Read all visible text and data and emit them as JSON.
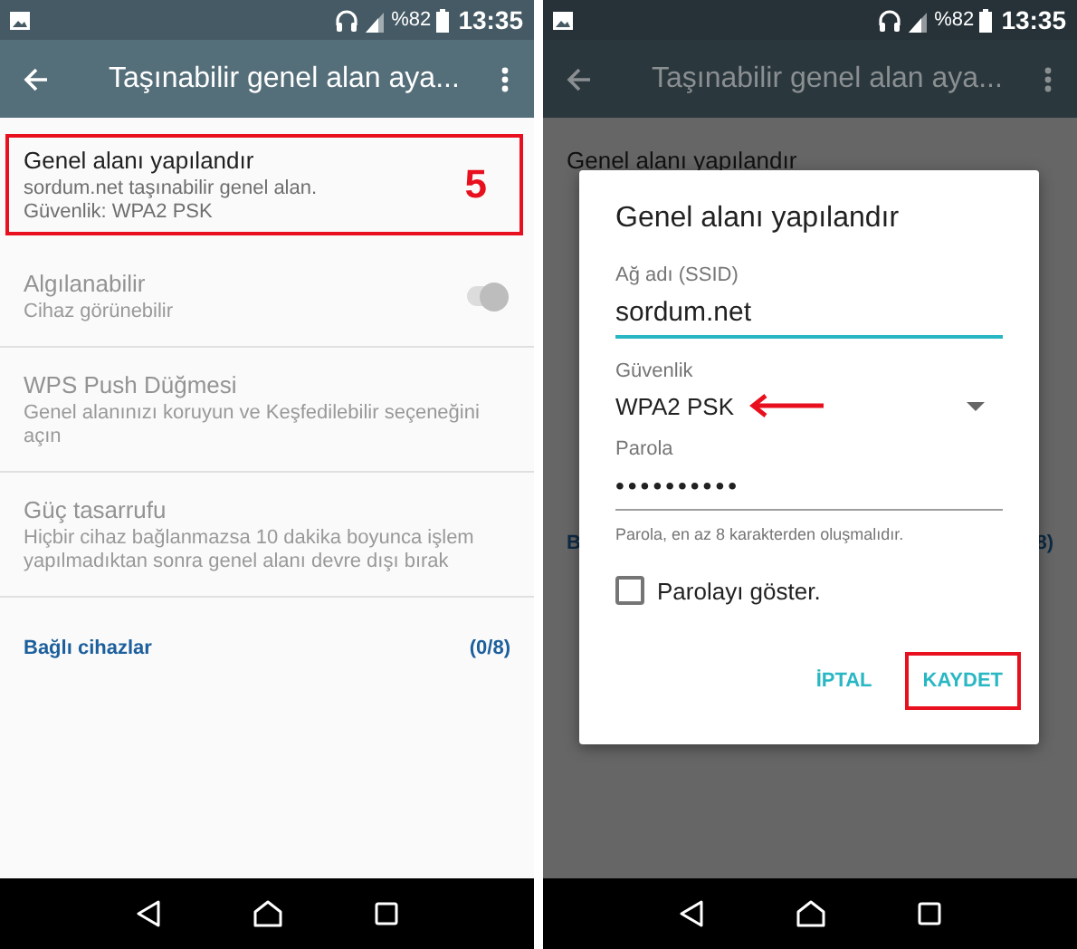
{
  "screens": [
    {
      "status_bar": {
        "battery": "%82",
        "time": "13:35"
      },
      "app_bar": {
        "title": "Taşınabilir genel alan aya..."
      },
      "dimmed": false,
      "items": [
        {
          "title": "Genel alanı yapılandır",
          "lines": [
            "sordum.net taşınabilir genel alan.",
            "Güvenlik: WPA2 PSK"
          ],
          "disabled": false,
          "highlight": true,
          "badge": "5"
        },
        {
          "title": "Algılanabilir",
          "lines": [
            "Cihaz görünebilir"
          ],
          "disabled": true,
          "highlight": false,
          "toggle": {
            "on": true
          }
        },
        {
          "title": "WPS Push Düğmesi",
          "lines": [
            "Genel alanınızı koruyun ve Keşfedilebilir seçeneğini açın"
          ],
          "disabled": true,
          "highlight": false
        },
        {
          "title": "Güç tasarrufu",
          "lines": [
            "Hiçbir cihaz bağlanmazsa 10 dakika boyunca işlem yapılmadıktan sonra genel alanı devre dışı bırak"
          ],
          "disabled": true,
          "highlight": false
        }
      ],
      "footer": {
        "label": "Bağlı cihazlar",
        "count": "(0/8)"
      }
    },
    {
      "status_bar": {
        "battery": "%82",
        "time": "13:35"
      },
      "app_bar": {
        "title": "Taşınabilir genel alan aya..."
      },
      "dimmed": true,
      "items": [
        {
          "title": "Genel alanı yapılandır",
          "disabled": false,
          "highlight": false
        }
      ],
      "footer": {
        "label": "B",
        "count": "8)"
      },
      "dialog": {
        "title": "Genel alanı yapılandır",
        "fields": [
          {
            "kind": "text",
            "label": "Ağ adı (SSID)",
            "value": "sordum.net",
            "focused": true
          },
          {
            "kind": "dropdown",
            "label": "Güvenlik",
            "value": "WPA2 PSK",
            "arrow": true
          },
          {
            "kind": "password",
            "label": "Parola",
            "value": "••••••••••",
            "focused": false,
            "hint": "Parola, en az 8 karakterden oluşmalıdır."
          }
        ],
        "checkbox": {
          "label": "Parolayı göster.",
          "checked": false
        },
        "buttons": [
          {
            "label": "İPTAL",
            "highlight": false
          },
          {
            "label": "KAYDET",
            "highlight": true
          }
        ]
      }
    }
  ]
}
